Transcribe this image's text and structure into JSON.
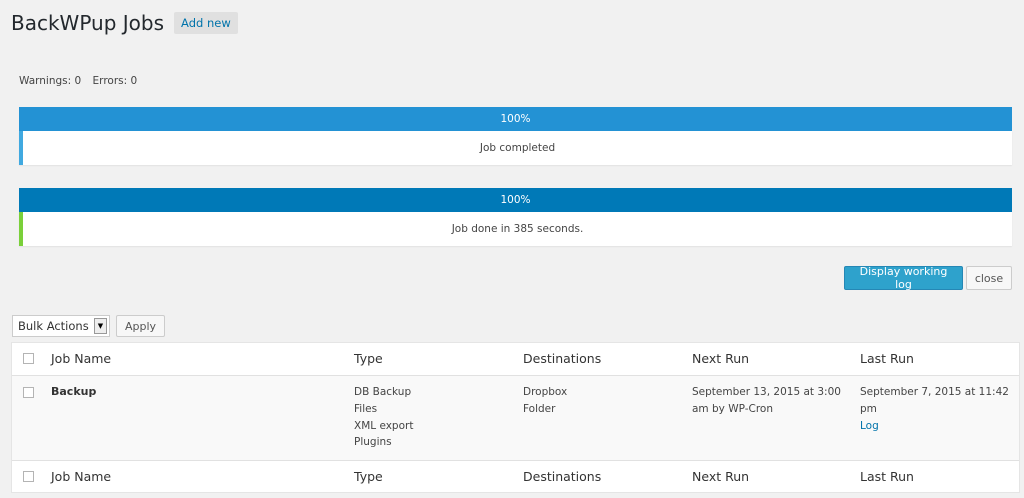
{
  "header": {
    "title": "BackWPup Jobs",
    "add_new": "Add new"
  },
  "counts": {
    "warnings": "Warnings: 0",
    "errors": "Errors: 0"
  },
  "progress": [
    {
      "percent": 100,
      "label": "100%",
      "message": "Job completed",
      "bar_color": "#2392d4",
      "accent_color": "#40a9e0"
    },
    {
      "percent": 100,
      "label": "100%",
      "message": "Job done in 385 seconds.",
      "bar_color": "#0079b7",
      "accent_color": "#7ad03a"
    }
  ],
  "actions": {
    "display_log": "Display working log",
    "close": "close"
  },
  "bulk": {
    "selected": "Bulk Actions",
    "apply": "Apply"
  },
  "table": {
    "columns": [
      "Job Name",
      "Type",
      "Destinations",
      "Next Run",
      "Last Run"
    ],
    "rows": [
      {
        "name": "Backup",
        "types": [
          "DB Backup",
          "Files",
          "XML export",
          "Plugins"
        ],
        "destinations": [
          "Dropbox",
          "Folder"
        ],
        "next_run": "September 13, 2015 at 3:00 am by WP-Cron",
        "last_run": "September 7, 2015 at 11:42 pm",
        "log": "Log"
      }
    ]
  }
}
